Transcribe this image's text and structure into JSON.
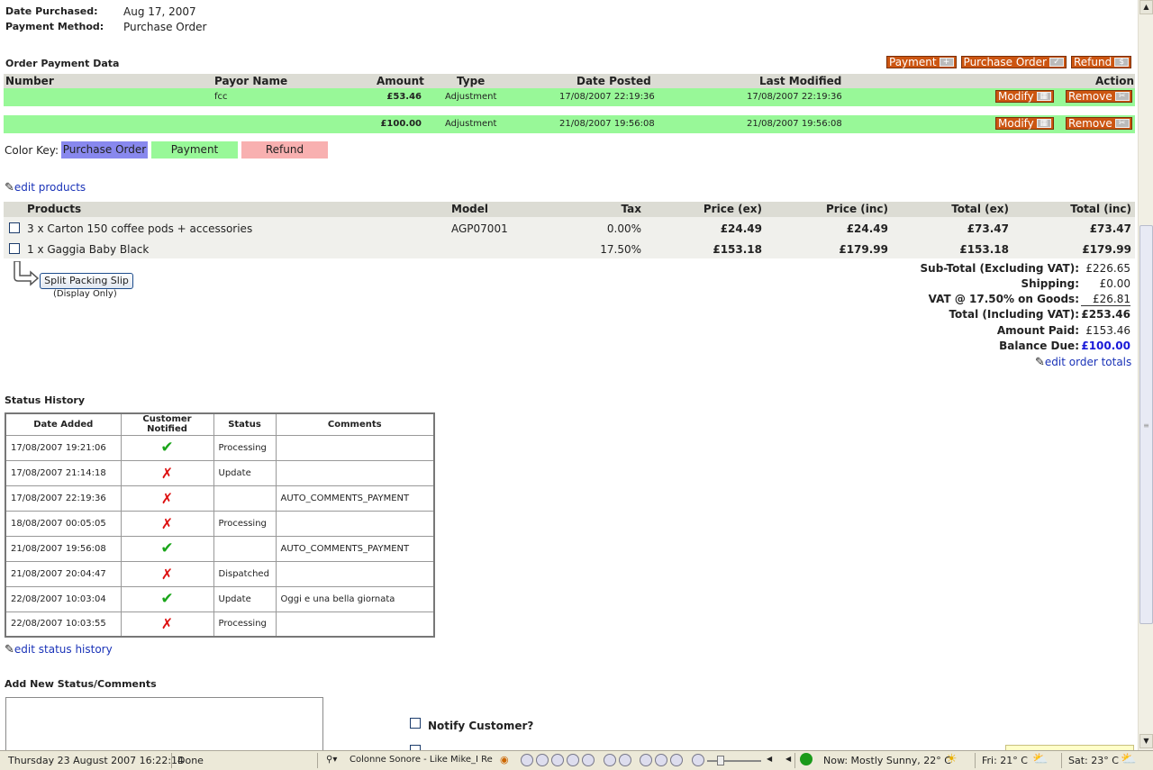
{
  "order_info": {
    "date_purchased_label": "Date Purchased:",
    "date_purchased": "Aug 17, 2007",
    "payment_method_label": "Payment Method:",
    "payment_method": "Purchase Order"
  },
  "payment_data": {
    "title": "Order Payment Data",
    "buttons": {
      "payment": "Payment",
      "purchase_order": "Purchase Order",
      "refund": "Refund"
    },
    "headers": {
      "number": "Number",
      "payor": "Payor Name",
      "amount": "Amount",
      "type": "Type",
      "date_posted": "Date Posted",
      "last_modified": "Last Modified",
      "action": "Action"
    },
    "rows": [
      {
        "number": "",
        "payor": "fcc",
        "amount": "£53.46",
        "type": "Adjustment",
        "date_posted": "17/08/2007 22:19:36",
        "last_modified": "17/08/2007 22:19:36",
        "modify": "Modify",
        "remove": "Remove"
      },
      {
        "number": "",
        "payor": "",
        "amount": "£100.00",
        "type": "Adjustment",
        "date_posted": "21/08/2007 19:56:08",
        "last_modified": "21/08/2007 19:56:08",
        "modify": "Modify",
        "remove": "Remove"
      }
    ],
    "color_key_label": "Color Key:",
    "color_key": [
      {
        "label": "Purchase Order",
        "color": "#8888ee"
      },
      {
        "label": "Payment",
        "color": "#98f898"
      },
      {
        "label": "Refund",
        "color": "#f8b0b0"
      }
    ]
  },
  "products": {
    "edit_link": "edit products",
    "headers": {
      "products": "Products",
      "model": "Model",
      "tax": "Tax",
      "price_ex": "Price (ex)",
      "price_inc": "Price (inc)",
      "total_ex": "Total (ex)",
      "total_inc": "Total (inc)"
    },
    "rows": [
      {
        "name": "3 x Carton 150 coffee pods + accessories",
        "model": "AGP07001",
        "tax": "0.00%",
        "price_ex": "£24.49",
        "price_inc": "£24.49",
        "total_ex": "£73.47",
        "total_inc": "£73.47"
      },
      {
        "name": "1 x Gaggia Baby Black",
        "model": "",
        "tax": "17.50%",
        "price_ex": "£153.18",
        "price_inc": "£179.99",
        "total_ex": "£153.18",
        "total_inc": "£179.99"
      }
    ],
    "split_button": "Split Packing Slip",
    "split_note": "(Display Only)"
  },
  "totals": {
    "subtotal_label": "Sub-Total (Excluding VAT):",
    "subtotal": "£226.65",
    "shipping_label": "Shipping:",
    "shipping": "£0.00",
    "vat_label": "VAT @ 17.50% on Goods:",
    "vat": "£26.81",
    "total_label": "Total (Including VAT):",
    "total": "£253.46",
    "paid_label": "Amount Paid:",
    "paid": "£153.46",
    "balance_label": "Balance Due:",
    "balance": "£100.00",
    "edit_link": "edit order totals"
  },
  "status_history": {
    "title": "Status History",
    "headers": {
      "date": "Date Added",
      "notified": "Customer Notified",
      "status": "Status",
      "comments": "Comments"
    },
    "rows": [
      {
        "date": "17/08/2007 19:21:06",
        "notified": true,
        "status": "Processing",
        "comments": ""
      },
      {
        "date": "17/08/2007 21:14:18",
        "notified": false,
        "status": "Update",
        "comments": ""
      },
      {
        "date": "17/08/2007 22:19:36",
        "notified": false,
        "status": "",
        "comments": "AUTO_COMMENTS_PAYMENT"
      },
      {
        "date": "18/08/2007 00:05:05",
        "notified": false,
        "status": "Processing",
        "comments": ""
      },
      {
        "date": "21/08/2007 19:56:08",
        "notified": true,
        "status": "",
        "comments": "AUTO_COMMENTS_PAYMENT"
      },
      {
        "date": "21/08/2007 20:04:47",
        "notified": false,
        "status": "Dispatched",
        "comments": ""
      },
      {
        "date": "22/08/2007 10:03:04",
        "notified": true,
        "status": "Update",
        "comments": "Oggi e una bella giornata"
      },
      {
        "date": "22/08/2007 10:03:55",
        "notified": false,
        "status": "Processing",
        "comments": ""
      }
    ],
    "edit_link": "edit status history"
  },
  "new_status": {
    "title": "Add New Status/Comments",
    "notify_label": "Notify Customer?"
  },
  "statusbar": {
    "datetime": "Thursday 23 August 2007 16:22:14",
    "done": "Done",
    "now_playing": "Colonne Sonore - Like Mike_I Re",
    "weather_now": "Now: Mostly Sunny, 22° C",
    "weather_fri": "Fri: 21° C",
    "weather_sat": "Sat: 23° C"
  }
}
